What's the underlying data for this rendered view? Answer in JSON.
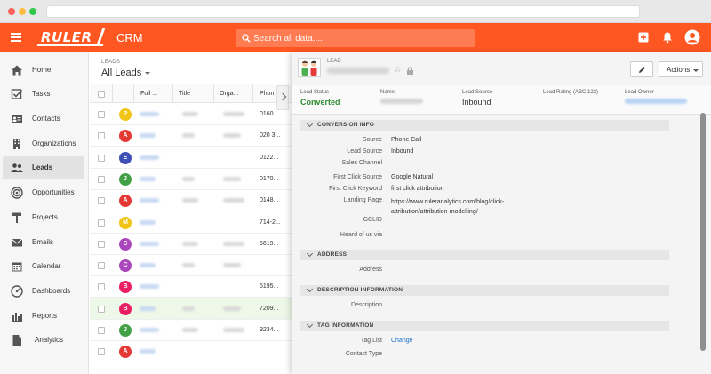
{
  "app": {
    "logo": "RULER",
    "name": "CRM"
  },
  "search": {
    "placeholder": "Search all data...."
  },
  "sidebar": {
    "items": [
      {
        "label": "Home",
        "icon": "home-icon"
      },
      {
        "label": "Tasks",
        "icon": "check-square-icon"
      },
      {
        "label": "Contacts",
        "icon": "contact-card-icon"
      },
      {
        "label": "Organizations",
        "icon": "building-icon"
      },
      {
        "label": "Leads",
        "icon": "people-icon",
        "active": true
      },
      {
        "label": "Opportunities",
        "icon": "target-icon"
      },
      {
        "label": "Projects",
        "icon": "hammer-icon"
      },
      {
        "label": "Emails",
        "icon": "envelope-icon"
      },
      {
        "label": "Calendar",
        "icon": "calendar-icon"
      },
      {
        "label": "Dashboards",
        "icon": "gauge-icon"
      },
      {
        "label": "Reports",
        "icon": "bar-chart-icon"
      },
      {
        "label": "Analytics",
        "icon": "document-icon"
      }
    ]
  },
  "list": {
    "crumb": "LEADS",
    "title": "All Leads",
    "columns": [
      "Full ...",
      "Title",
      "Orga...",
      "Phon"
    ],
    "rows": [
      {
        "initial": "P",
        "color": "#f2c418",
        "phone": "0160..."
      },
      {
        "initial": "A",
        "color": "#e53935",
        "phone": "020 3..."
      },
      {
        "initial": "E",
        "color": "#3f51b5",
        "phone": "0122..."
      },
      {
        "initial": "J",
        "color": "#43a047",
        "phone": "0170..."
      },
      {
        "initial": "A",
        "color": "#e53935",
        "phone": "0148..."
      },
      {
        "initial": "M",
        "color": "#f2c418",
        "phone": "714-2..."
      },
      {
        "initial": "C",
        "color": "#ab47bc",
        "phone": "5619..."
      },
      {
        "initial": "C",
        "color": "#ab47bc",
        "phone": ""
      },
      {
        "initial": "B",
        "color": "#e91e63",
        "phone": "5195..."
      },
      {
        "initial": "B",
        "color": "#e91e63",
        "phone": "7209...",
        "highlight": true
      },
      {
        "initial": "J",
        "color": "#43a047",
        "phone": "9234..."
      },
      {
        "initial": "A",
        "color": "#e53935",
        "phone": ""
      }
    ]
  },
  "detail": {
    "crumb": "LEAD",
    "actions_label": "Actions",
    "summary": {
      "status_label": "Lead Status",
      "status_value": "Converted",
      "name_label": "Name",
      "source_label": "Lead Source",
      "source_value": "Inbound",
      "rating_label": "Lead Rating (ABC,123)",
      "owner_label": "Lead Owner"
    },
    "sections": {
      "conversion": "CONVERSION INFO",
      "address": "ADDRESS",
      "description": "DESCRIPTION INFORMATION",
      "tags": "TAG INFORMATION"
    },
    "conversion_fields": [
      {
        "label": "Source",
        "value": "Phone Call"
      },
      {
        "label": "Lead Source",
        "value": "Inbound"
      },
      {
        "label": "Sales Channel",
        "value": ""
      },
      {
        "label": "First Click Source",
        "value": "Google Natural"
      },
      {
        "label": "First Click Keyword",
        "value": "first click attribution"
      },
      {
        "label": "Landing Page",
        "value": "https://www.ruleranalytics.com/blog/click-attribution/attribution-modelling/"
      },
      {
        "label": "GCLID",
        "value": ""
      },
      {
        "label": "Heard of us via",
        "value": ""
      }
    ],
    "address_fields": [
      {
        "label": "Address",
        "value": ""
      }
    ],
    "description_fields": [
      {
        "label": "Description",
        "value": ""
      }
    ],
    "tag_fields": [
      {
        "label": "Tag List",
        "value": "Change"
      },
      {
        "label": "Contact Type",
        "value": ""
      }
    ]
  },
  "colors": {
    "brand": "#ff5722",
    "converted": "#2e8b2e",
    "link": "#1a6fc9"
  }
}
